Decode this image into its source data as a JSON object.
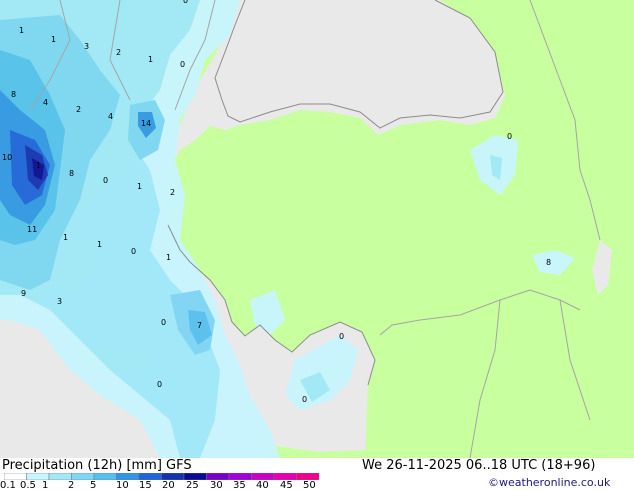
{
  "title": "Precipitation (12h) [mm] GFS",
  "datetime": "We 26-11-2025 06..18 UTC (18+96)",
  "credit": "©weatheronline.co.uk",
  "colors": {
    "sea": "#e9e9e9",
    "land": "#c8ff9f",
    "border": "#a5a5a5",
    "coast": "#8c8c8c",
    "label": "#000000"
  },
  "legend": {
    "ticks": [
      "0.1",
      "0.5",
      "1",
      "2",
      "5",
      "10",
      "15",
      "20",
      "25",
      "30",
      "35",
      "40",
      "45",
      "50"
    ],
    "colors": [
      "#ffffff",
      "#c8f5ff",
      "#a0e8fa",
      "#7dd6f5",
      "#55c0ee",
      "#3296e6",
      "#1e64dc",
      "#1432b4",
      "#0a0a96",
      "#7800c8",
      "#a000dc",
      "#c800c8",
      "#e600b4",
      "#f0008c"
    ]
  },
  "point_values": [
    "1",
    "1",
    "3",
    "2",
    "1",
    "0",
    "8",
    "4",
    "2",
    "4",
    "14",
    "10",
    "1",
    "8",
    "0",
    "1",
    "2",
    "11",
    "1",
    "1",
    "0",
    "1",
    "9",
    "3",
    "0",
    "7",
    "0",
    "0",
    "0",
    "0",
    "0",
    "8"
  ]
}
